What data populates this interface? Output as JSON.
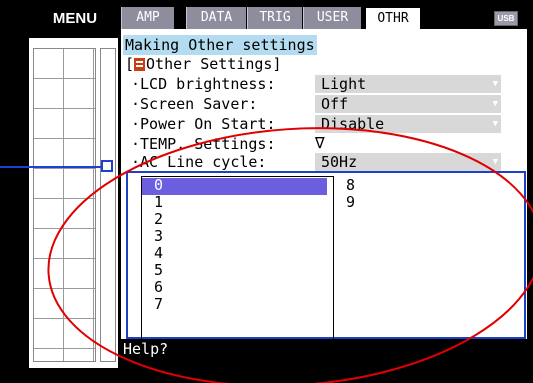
{
  "menu_label": "MENU",
  "tabs": [
    {
      "label": "AMP"
    },
    {
      "label": "DATA"
    },
    {
      "label": "TRIG"
    },
    {
      "label": "USER"
    },
    {
      "label": "OTHR"
    }
  ],
  "usb_label": "USB",
  "screen_title": "Making Other settings",
  "section_title": "[ Other Settings]",
  "settings": [
    {
      "label": "·LCD brightness:",
      "value": "Light"
    },
    {
      "label": "·Screen Saver:",
      "value": "Off"
    },
    {
      "label": "·Power On Start:",
      "value": "Disable"
    },
    {
      "label": "·TEMP. Settings:",
      "value": "∇"
    },
    {
      "label": "·AC Line cycle:",
      "value": "50Hz"
    }
  ],
  "popup": {
    "items": [
      "0",
      "1",
      "2",
      "3",
      "4",
      "5",
      "6",
      "7",
      "8",
      "9"
    ],
    "selected": "0"
  },
  "help_text": "Help?",
  "colors": {
    "tab_bg": "#8d8d9d",
    "title_bg": "#b4dcf0",
    "popup_border": "#1e3fc8",
    "selection": "#6b5fe0",
    "annotation": "#e00000"
  }
}
